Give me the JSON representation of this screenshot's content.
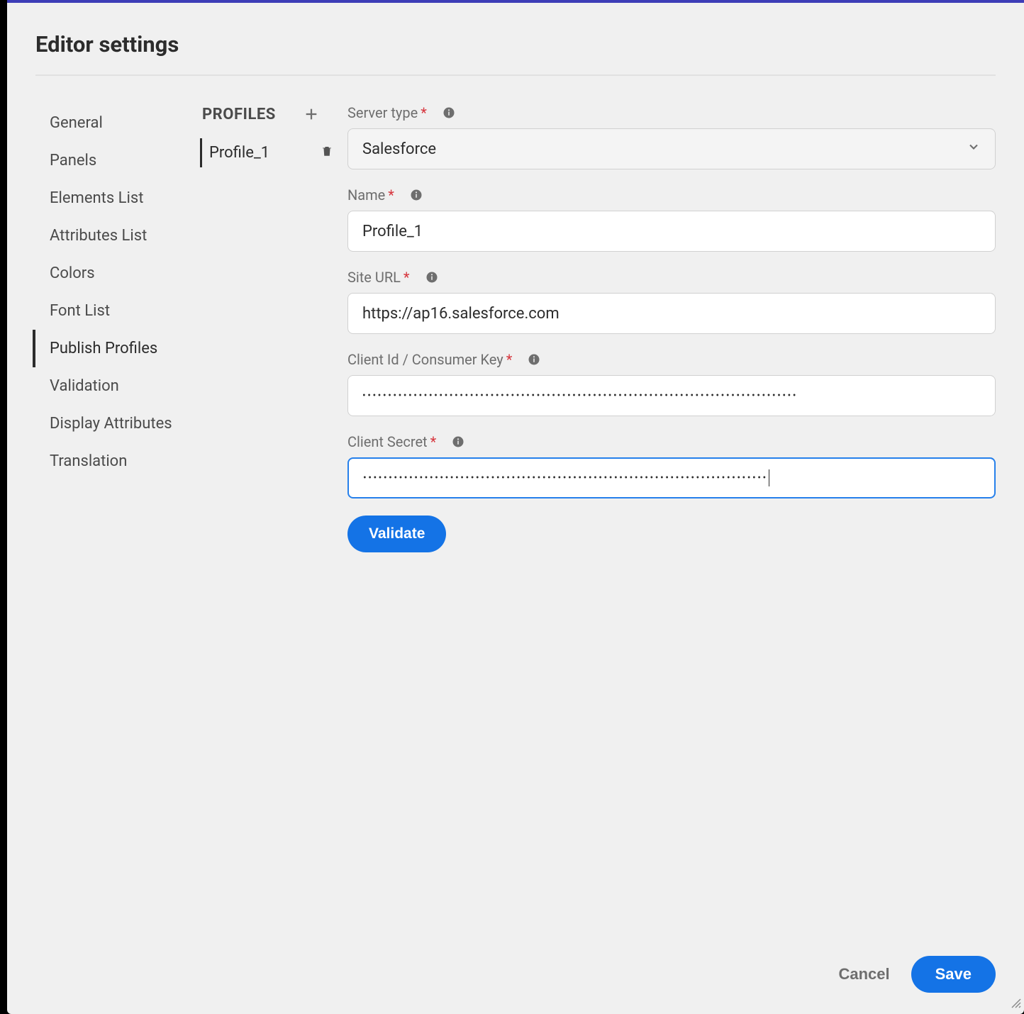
{
  "header": {
    "title": "Editor settings"
  },
  "sidebar": {
    "items": [
      {
        "label": "General",
        "active": false
      },
      {
        "label": "Panels",
        "active": false
      },
      {
        "label": "Elements List",
        "active": false
      },
      {
        "label": "Attributes List",
        "active": false
      },
      {
        "label": "Colors",
        "active": false
      },
      {
        "label": "Font List",
        "active": false
      },
      {
        "label": "Publish Profiles",
        "active": true
      },
      {
        "label": "Validation",
        "active": false
      },
      {
        "label": "Display Attributes",
        "active": false
      },
      {
        "label": "Translation",
        "active": false
      }
    ]
  },
  "profiles": {
    "heading": "PROFILES",
    "items": [
      {
        "label": "Profile_1"
      }
    ]
  },
  "form": {
    "server_type": {
      "label": "Server type",
      "value": "Salesforce"
    },
    "name": {
      "label": "Name",
      "value": "Profile_1"
    },
    "site_url": {
      "label": "Site URL",
      "value": "https://ap16.salesforce.com"
    },
    "client_id": {
      "label": "Client Id / Consumer Key",
      "mask": "•••••••••••••••••••••••••••••••••••••••••••••••••••••••••••••••••••••••••••••••••••••"
    },
    "client_secret": {
      "label": "Client Secret",
      "mask": "•••••••••••••••••••••••••••••••••••••••••••••••••••••••••••••••••••••••••••••••"
    },
    "validate_label": "Validate"
  },
  "footer": {
    "cancel": "Cancel",
    "save": "Save"
  }
}
